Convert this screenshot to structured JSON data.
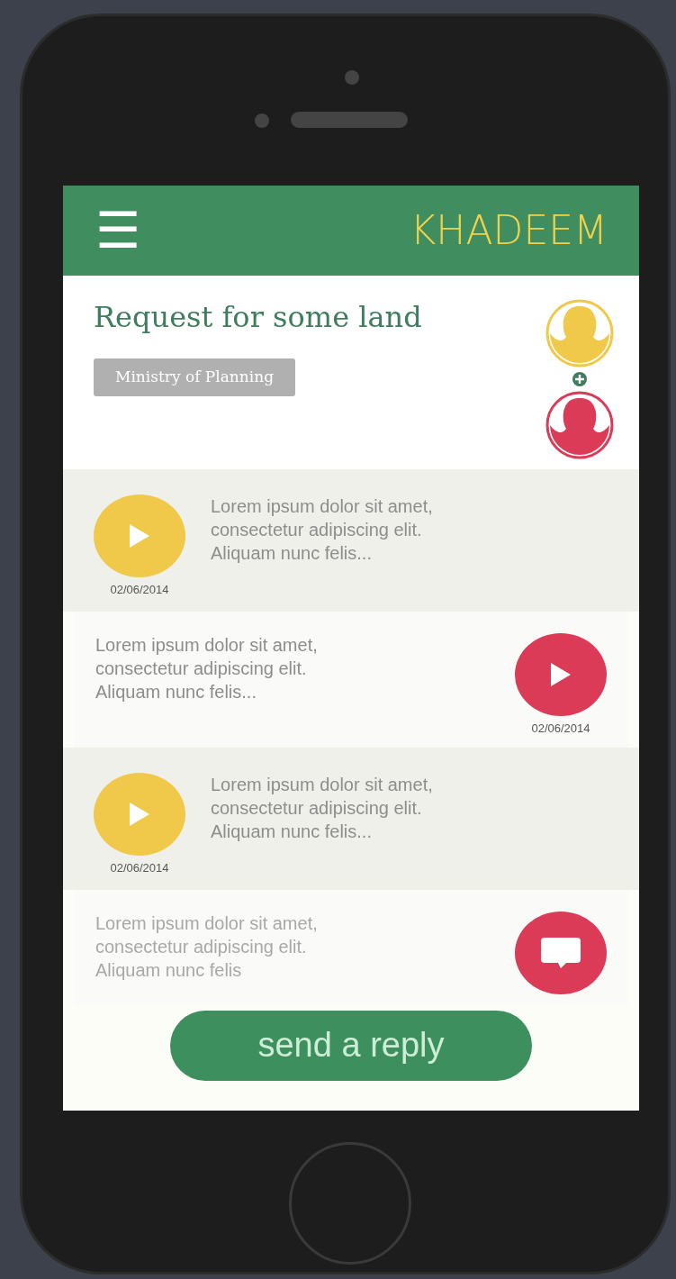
{
  "header": {
    "menu_icon": "☰",
    "brand": "KHADEEM"
  },
  "request": {
    "title": "Request for some land",
    "tag": "Ministry of Planning",
    "participants": [
      {
        "color": "#f0c84a"
      },
      {
        "color": "#dc3b58"
      }
    ]
  },
  "messages": [
    {
      "kind": "voice_in",
      "color": "#f0c84a",
      "text": "Lorem ipsum dolor sit amet,\nconsectetur adipiscing elit.\nAliquam nunc felis...",
      "date": "02/06/2014"
    },
    {
      "kind": "voice_out",
      "color": "#dc3b58",
      "text": "Lorem ipsum dolor sit amet,\nconsectetur adipiscing elit.\nAliquam nunc felis...",
      "date": "02/06/2014"
    },
    {
      "kind": "voice_in",
      "color": "#f0c84a",
      "text": "Lorem ipsum dolor sit amet,\nconsectetur adipiscing elit.\nAliquam nunc felis...",
      "date": "02/06/2014"
    },
    {
      "kind": "text_out",
      "color": "#dc3b58",
      "text": "Lorem ipsum dolor sit amet,\nconsectetur adipiscing elit.\nAliquam nunc felis"
    }
  ],
  "reply_button": "send a reply"
}
